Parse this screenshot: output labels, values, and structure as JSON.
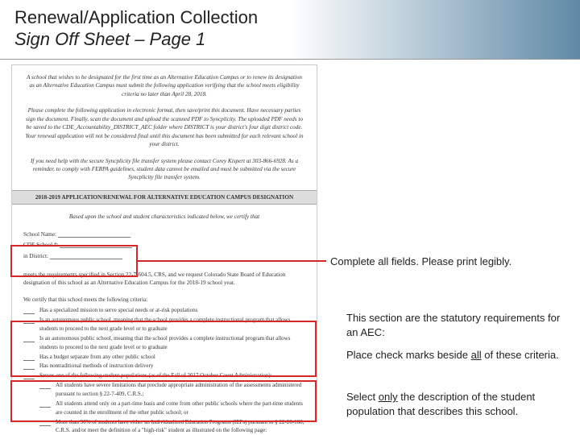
{
  "header": {
    "title": "Renewal/Application Collection",
    "subtitle": "Sign Off Sheet – Page 1"
  },
  "doc": {
    "p1": "A school that wishes to be designated for the first time as an Alternative Education Campus or to renew its designation as an Alternative Education Campus must submit the following application verifying that the school meets eligibility criteria no later than April 28, 2018.",
    "p2": "Please complete the following application in electronic format, then save/print this document. Have necessary parties sign the document. Finally, scan the document and upload the scanned PDF to Syncplicity. The uploaded PDF needs to be saved to the CDE_Accountability_DISTRICT_AEC folder where DISTRICT is your district's four digit district code. Your renewal application will not be considered final until this document has been submitted for each relevant school in your district.",
    "p3": "If you need help with the secure Syncplicity file transfer system please contact Corey Kispert at 303-866-6928. As a reminder, to comply with FERPA guidelines, student data cannot be emailed and must be submitted via the secure Syncplicity file transfer system.",
    "bar": "2018-2019 APPLICATION/RENEWAL FOR ALTERNATIVE EDUCATION CAMPUS DESIGNATION",
    "p4": "Based upon the school and student characteristics indicated below, we certify that",
    "f1": "School Name:",
    "f2": "CDE School #:",
    "f3": "in District:",
    "p5": "meets the requirements specified in Section 22-7-604.5, CRS, and we request Colorado State Board of Education designation of this school as an Alternative Education Campus for the 2018-19 school year.",
    "c_intro": "We certify that this school meets the following criteria:",
    "c1": "Has a specialized mission to serve special needs or at-risk populations",
    "c2": "Is an autonomous public school, meaning that the school provides a complete instructional program that allows students to proceed to the next grade level or to graduate",
    "c3": "Is an autonomous public school, meaning that the school provides a complete instructional program that allows students to proceed to the next grade level or to graduate",
    "c4": "Has a budget separate from any other public school",
    "c5": "Has nontraditional methods of instruction delivery",
    "c6": "Serves one of the following student populations (as of the Fall of 2017 October Count Administration):",
    "c6a": "All students have severe limitations that preclude appropriate administration of the assessments administered pursuant to section § 22-7-409, C.R.S.;",
    "c6b": "All students attend only on a part-time basis and come from other public schools where the part-time students are counted in the enrollment of the other public school; or",
    "c6c": "More than 90% of students have either an Individualized Education Programs (IEPs) pursuant to § 22-20-108, C.R.S. and/or meet the definition of a \"high-risk\" student as illustrated on the following page:"
  },
  "notes": {
    "n1": "Complete all fields. Please print legibly.",
    "n2a": "This section are the statutory requirements for an AEC:",
    "n3a": "Place check marks beside ",
    "n3b": "all",
    "n3c": " of these criteria.",
    "n4a": "Select ",
    "n4b": "only",
    "n4c": " the description of the student population that describes this school."
  }
}
